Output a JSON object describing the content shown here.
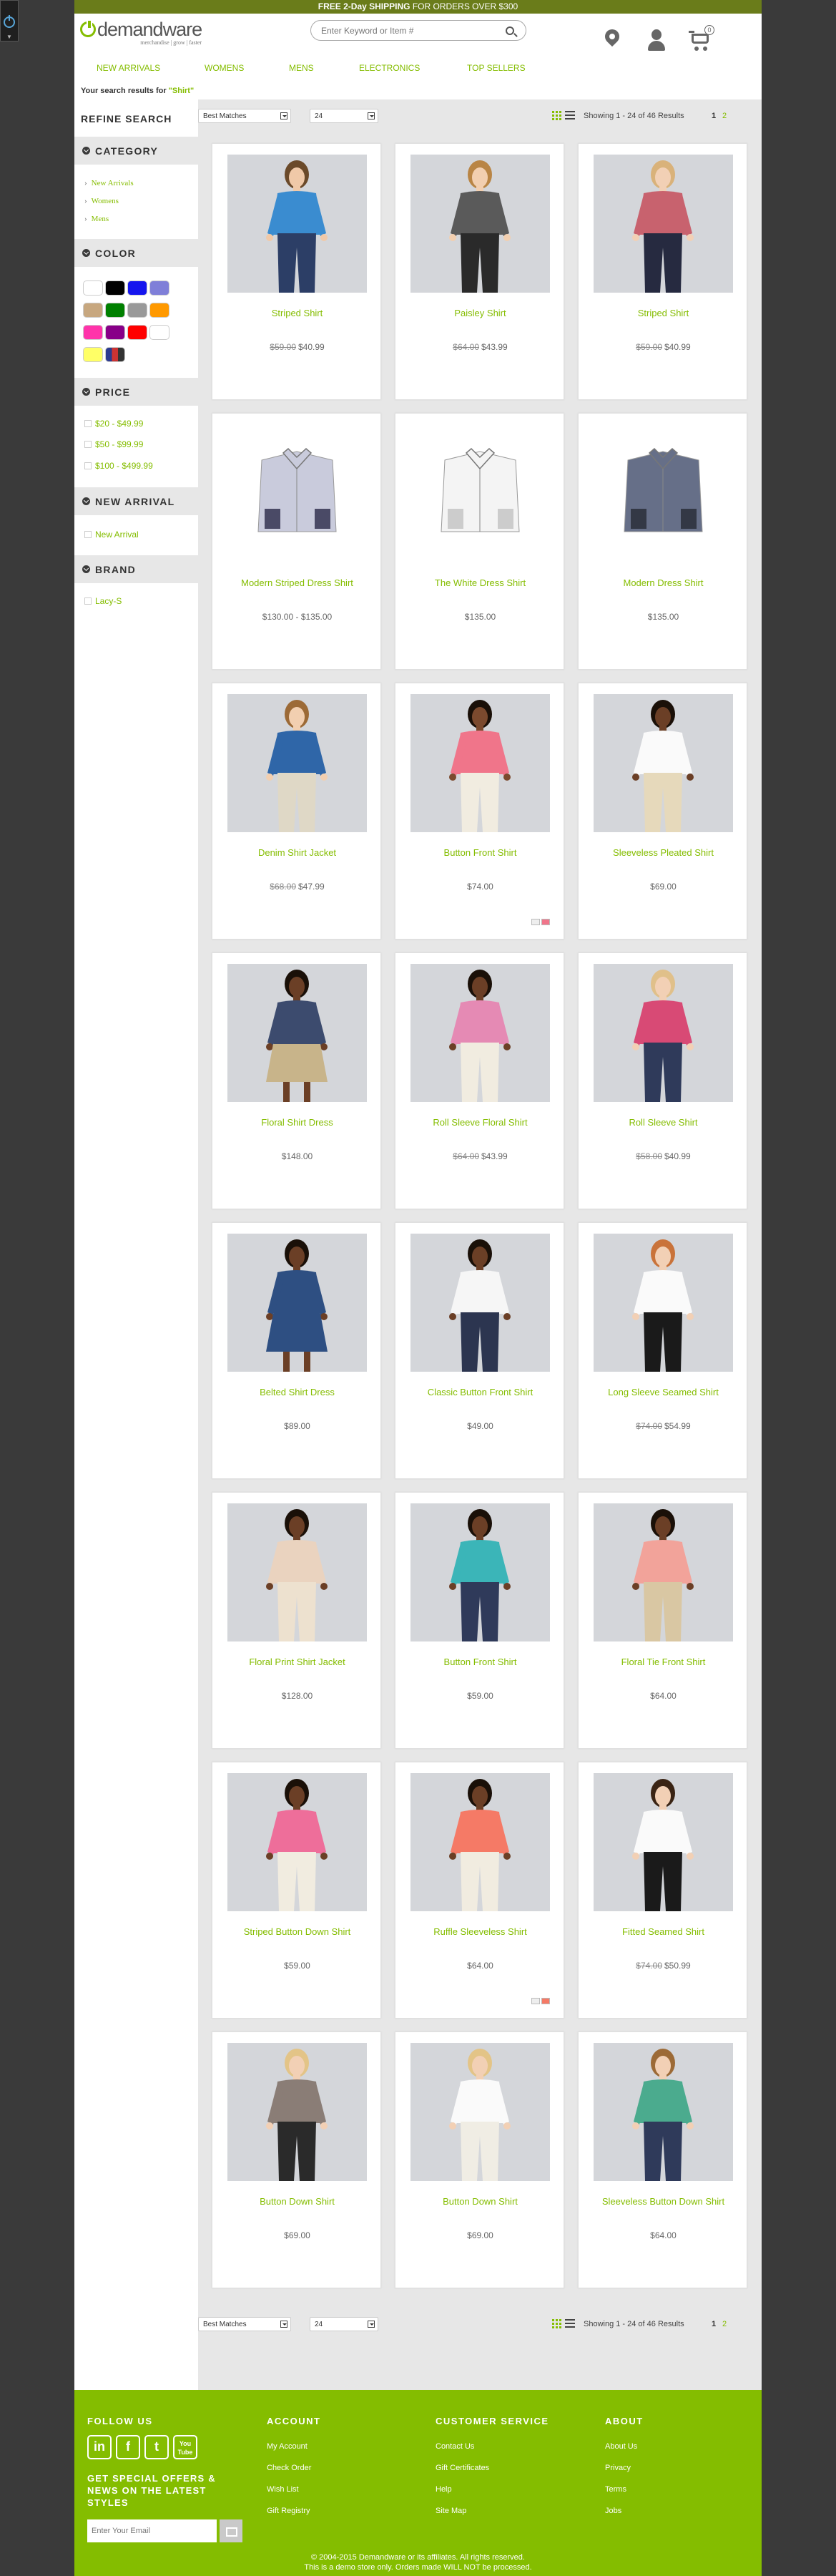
{
  "promo": {
    "strong": "FREE 2-Day SHIPPING",
    "rest": "FOR ORDERS OVER $300"
  },
  "brand": {
    "name": "demandware",
    "tagline": "merchandise | grow | faster"
  },
  "search": {
    "placeholder": "Enter Keyword or Item #"
  },
  "cart": {
    "count": "0"
  },
  "nav": [
    "NEW ARRIVALS",
    "WOMENS",
    "MENS",
    "ELECTRONICS",
    "TOP SELLERS"
  ],
  "breadcrumb": {
    "prefix": "Your search results for ",
    "term": "\"Shirt\""
  },
  "refine": {
    "title": "REFINE SEARCH",
    "category_title": "CATEGORY",
    "categories": [
      "New Arrivals",
      "Womens",
      "Mens"
    ],
    "color_title": "COLOR",
    "colors": [
      "#ffffff",
      "#000000",
      "#1515ee",
      "#7f7fd8",
      "#c7a77f",
      "#008000",
      "#999999",
      "#ff9900",
      "#ff33aa",
      "#880088",
      "#ff0000",
      "#ffffff",
      "#ffff66",
      "multi"
    ],
    "price_title": "PRICE",
    "prices": [
      "$20 - $49.99",
      "$50 - $99.99",
      "$100 - $499.99"
    ],
    "new_arrival_title": "NEW ARRIVAL",
    "new_arrivals": [
      "New Arrival"
    ],
    "brand_title": "BRAND",
    "brands": [
      "Lacy-S"
    ]
  },
  "toolbar": {
    "sort": "Best Matches",
    "page_size": "24",
    "results": "Showing 1 - 24 of 46 Results",
    "current_page": "1",
    "next_page": "2"
  },
  "products": [
    {
      "name": "Striped Shirt",
      "was": "$59.00",
      "price": "$40.99",
      "top": "#3a8cd0",
      "bottom": "#2c3e66",
      "skin": "#f0c9a8",
      "hair": "#6b4a2a",
      "bg": "#d4d6da",
      "kind": "woman"
    },
    {
      "name": "Paisley Shirt",
      "was": "$64.00",
      "price": "$43.99",
      "top": "#5a5a5a",
      "bottom": "#2a2a2a",
      "skin": "#f2cfb0",
      "hair": "#b98545",
      "bg": "#d4d6da",
      "kind": "woman"
    },
    {
      "name": "Striped Shirt",
      "was": "$59.00",
      "price": "$40.99",
      "top": "#c8626e",
      "bottom": "#262a40",
      "skin": "#f2d0b5",
      "hair": "#d9b27a",
      "bg": "#d4d6da",
      "kind": "woman"
    },
    {
      "name": "Modern Striped Dress Shirt",
      "was": "",
      "price": "$130.00 - $135.00",
      "top": "#c9cbdc",
      "bottom": "#4a4a66",
      "bg": "#ffffff",
      "kind": "folded"
    },
    {
      "name": "The White Dress Shirt",
      "was": "",
      "price": "$135.00",
      "top": "#f4f4f4",
      "bottom": "#cccccc",
      "bg": "#ffffff",
      "kind": "folded"
    },
    {
      "name": "Modern Dress Shirt",
      "was": "",
      "price": "$135.00",
      "top": "#666f88",
      "bottom": "#333845",
      "bg": "#ffffff",
      "kind": "folded"
    },
    {
      "name": "Denim Shirt Jacket",
      "was": "$68.00",
      "price": "$47.99",
      "top": "#2f66a8",
      "bottom": "#dfd8c6",
      "skin": "#f2cfb0",
      "hair": "#9c6a36",
      "bg": "#d4d6da",
      "kind": "woman"
    },
    {
      "name": "Button Front Shirt",
      "was": "",
      "price": "$74.00",
      "top": "#f0758a",
      "bottom": "#f1ece0",
      "skin": "#7b4a2e",
      "hair": "#1a1008",
      "bg": "#d4d6da",
      "kind": "woman",
      "swatches": [
        "#eeeeee",
        "#f0758a"
      ]
    },
    {
      "name": "Sleeveless Pleated Shirt",
      "was": "",
      "price": "$69.00",
      "top": "#fafafa",
      "bottom": "#e6d9bb",
      "skin": "#6b3f26",
      "hair": "#1a1008",
      "bg": "#d4d6da",
      "kind": "woman"
    },
    {
      "name": "Floral Shirt Dress",
      "was": "",
      "price": "$148.00",
      "top": "#3c4b6e",
      "bottom": "#c8b48a",
      "skin": "#6b3f26",
      "hair": "#1a1008",
      "bg": "#d4d6da",
      "kind": "dress"
    },
    {
      "name": "Roll Sleeve Floral Shirt",
      "was": "$64.00",
      "price": "$43.99",
      "top": "#e58ab4",
      "bottom": "#f1ece0",
      "skin": "#6b3f26",
      "hair": "#1a1008",
      "bg": "#d4d6da",
      "kind": "woman"
    },
    {
      "name": "Roll Sleeve Shirt",
      "was": "$58.00",
      "price": "$40.99",
      "top": "#d84a75",
      "bottom": "#2f3a5a",
      "skin": "#f2d0b5",
      "hair": "#e0c08a",
      "bg": "#d4d6da",
      "kind": "woman"
    },
    {
      "name": "Belted Shirt Dress",
      "was": "",
      "price": "$89.00",
      "top": "#2e4f82",
      "bottom": "#2e4f82",
      "skin": "#6b3f26",
      "hair": "#1a1008",
      "bg": "#d4d6da",
      "kind": "dress"
    },
    {
      "name": "Classic Button Front Shirt",
      "was": "",
      "price": "$49.00",
      "top": "#f6f6f6",
      "bottom": "#2c3550",
      "skin": "#6b3f26",
      "hair": "#1a1008",
      "bg": "#d4d6da",
      "kind": "woman"
    },
    {
      "name": "Long Sleeve Seamed Shirt",
      "was": "$74.00",
      "price": "$54.99",
      "top": "#fafafa",
      "bottom": "#1a1a1a",
      "skin": "#f2d0b5",
      "hair": "#c9733a",
      "bg": "#d4d6da",
      "kind": "woman"
    },
    {
      "name": "Floral Print Shirt Jacket",
      "was": "",
      "price": "$128.00",
      "top": "#ead3bf",
      "bottom": "#ede1cf",
      "skin": "#6b3f26",
      "hair": "#1a1008",
      "bg": "#d4d6da",
      "kind": "woman"
    },
    {
      "name": "Button Front Shirt",
      "was": "",
      "price": "$59.00",
      "top": "#3bb5b8",
      "bottom": "#2f3a5a",
      "skin": "#6b3f26",
      "hair": "#1a1008",
      "bg": "#d4d6da",
      "kind": "woman"
    },
    {
      "name": "Floral Tie Front Shirt",
      "was": "",
      "price": "$64.00",
      "top": "#f2a39a",
      "bottom": "#d9c7a3",
      "skin": "#6b3f26",
      "hair": "#1a1008",
      "bg": "#d4d6da",
      "kind": "woman"
    },
    {
      "name": "Striped Button Down Shirt",
      "was": "",
      "price": "$59.00",
      "top": "#ee6e9a",
      "bottom": "#f1ece0",
      "skin": "#6b3f26",
      "hair": "#1a1008",
      "bg": "#d4d6da",
      "kind": "woman"
    },
    {
      "name": "Ruffle Sleeveless Shirt",
      "was": "",
      "price": "$64.00",
      "top": "#f57a66",
      "bottom": "#f1ece0",
      "skin": "#6b3f26",
      "hair": "#1a1008",
      "bg": "#d4d6da",
      "kind": "woman",
      "swatches": [
        "#eeeeee",
        "#f57a66"
      ]
    },
    {
      "name": "Fitted Seamed Shirt",
      "was": "$74.00",
      "price": "$50.99",
      "top": "#fafafa",
      "bottom": "#1a1a1a",
      "skin": "#f2d0b5",
      "hair": "#3a2414",
      "bg": "#d4d6da",
      "kind": "woman"
    },
    {
      "name": "Button Down Shirt",
      "was": "",
      "price": "$69.00",
      "top": "#8a7d76",
      "bottom": "#2a2a2a",
      "skin": "#f2d0b5",
      "hair": "#e3c487",
      "bg": "#d4d6da",
      "kind": "woman"
    },
    {
      "name": "Button Down Shirt",
      "was": "",
      "price": "$69.00",
      "top": "#fafafa",
      "bottom": "#f0ede4",
      "skin": "#f2d0b5",
      "hair": "#e3c487",
      "bg": "#d4d6da",
      "kind": "woman"
    },
    {
      "name": "Sleeveless Button Down Shirt",
      "was": "",
      "price": "$64.00",
      "top": "#4bab8e",
      "bottom": "#2f3a5a",
      "skin": "#f2d0b5",
      "hair": "#9c6a36",
      "bg": "#d4d6da",
      "kind": "woman"
    }
  ],
  "footer": {
    "follow_title": "FOLLOW US",
    "social": [
      "in",
      "f",
      "t",
      "You Tube"
    ],
    "offer_text": "GET SPECIAL OFFERS & NEWS ON THE LATEST STYLES",
    "email_placeholder": "Enter Your Email",
    "account_title": "ACCOUNT",
    "account_links": [
      "My Account",
      "Check Order",
      "Wish List",
      "Gift Registry"
    ],
    "service_title": "CUSTOMER SERVICE",
    "service_links": [
      "Contact Us",
      "Gift Certificates",
      "Help",
      "Site Map"
    ],
    "about_title": "ABOUT",
    "about_links": [
      "About Us",
      "Privacy",
      "Terms",
      "Jobs"
    ],
    "copyright_1": "© 2004-2015 Demandware or its affiliates. All rights reserved.",
    "copyright_2": "This is a demo store only. Orders made WILL NOT be processed."
  }
}
